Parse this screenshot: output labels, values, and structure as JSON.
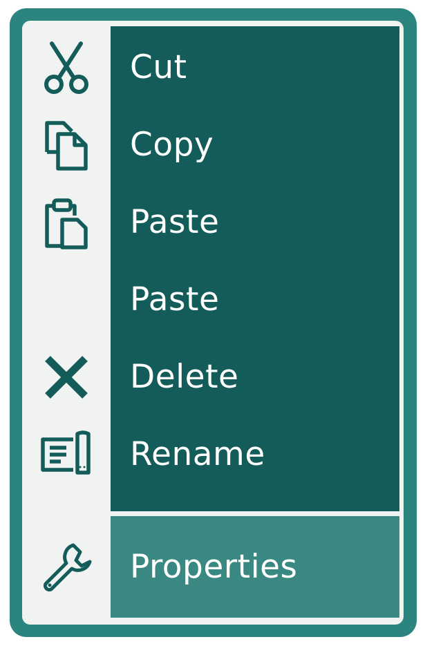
{
  "context_menu": {
    "colors": {
      "frame": "#2b847d",
      "gutter": "#f1f2f2",
      "panel": "#135c59",
      "highlight": "#3a8882",
      "icon": "#135c59",
      "label": "#ffffff"
    },
    "items": [
      {
        "label": "Cut",
        "icon": "scissors-icon"
      },
      {
        "label": "Copy",
        "icon": "copy-icon"
      },
      {
        "label": "Paste",
        "icon": "clipboard-paste-icon"
      },
      {
        "label": "Paste",
        "icon": ""
      },
      {
        "label": "Delete",
        "icon": "close-x-icon"
      },
      {
        "label": "Rename",
        "icon": "rename-field-icon"
      },
      {
        "label": "Properties",
        "icon": "wrench-icon",
        "highlighted": true
      }
    ]
  }
}
